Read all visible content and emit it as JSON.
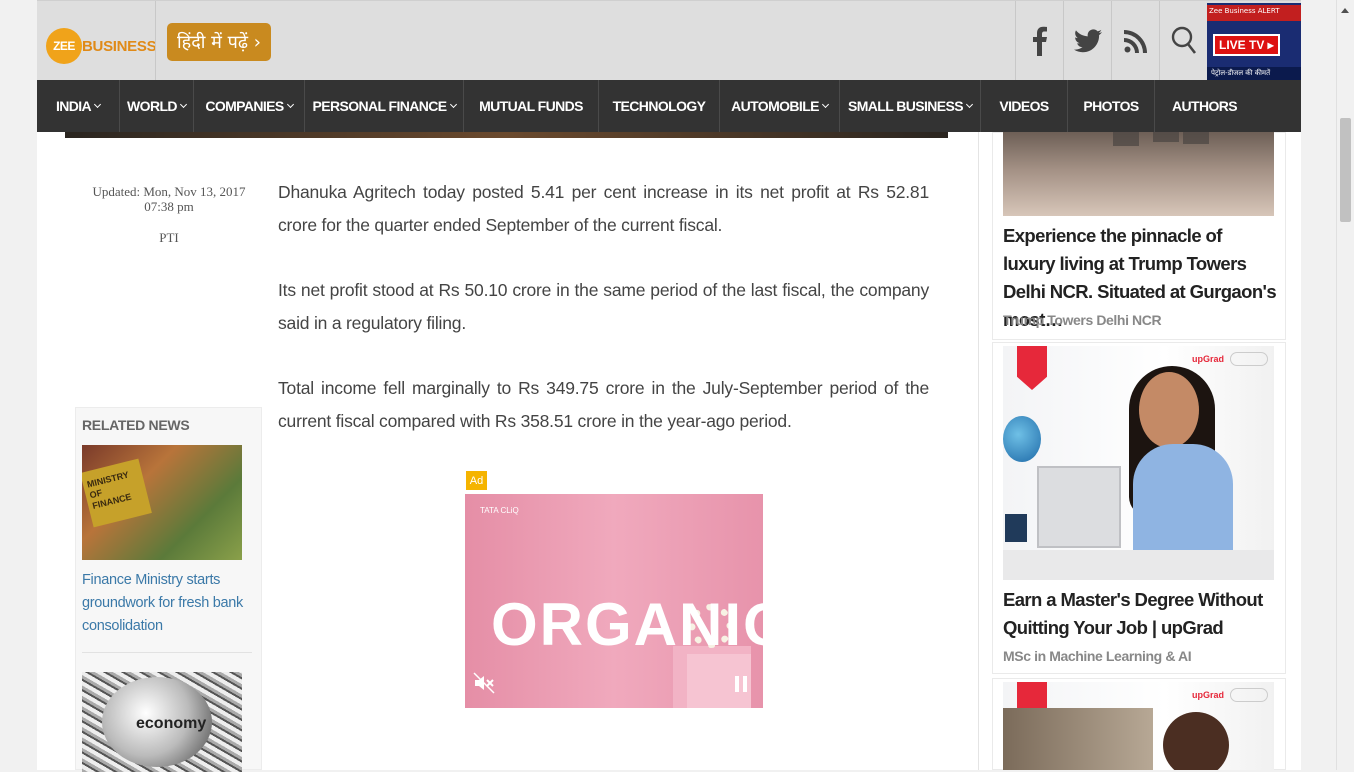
{
  "header": {
    "logo_badge": "ZEE",
    "logo_text": "BUSINESS",
    "hindi_button": "हिंदी में पढ़ें ›",
    "social_icons": [
      "facebook-icon",
      "twitter-icon",
      "rss-icon",
      "search-icon"
    ],
    "livetv": {
      "ticker": "Zee Business ALERT",
      "label": "LIVE TV ▸",
      "bottom_text": "पेट्रोल-डीजल की कीमतें"
    }
  },
  "nav": {
    "items": [
      {
        "label": "INDIA",
        "has_menu": true
      },
      {
        "label": "WORLD",
        "has_menu": true
      },
      {
        "label": "COMPANIES",
        "has_menu": true
      },
      {
        "label": "PERSONAL FINANCE",
        "has_menu": true
      },
      {
        "label": "MUTUAL FUNDS",
        "has_menu": false
      },
      {
        "label": "TECHNOLOGY",
        "has_menu": false
      },
      {
        "label": "AUTOMOBILE",
        "has_menu": true
      },
      {
        "label": "SMALL BUSINESS",
        "has_menu": true
      },
      {
        "label": "VIDEOS",
        "has_menu": false
      },
      {
        "label": "PHOTOS",
        "has_menu": false
      },
      {
        "label": "AUTHORS",
        "has_menu": false
      }
    ]
  },
  "article": {
    "updated": "Updated: Mon, Nov 13, 2017 07:38 pm",
    "author": "PTI",
    "paragraphs": [
      "Dhanuka Agritech today posted 5.41 per cent increase in its net profit at Rs 52.81 crore for the quarter ended September of the current fiscal.",
      "Its net profit stood at Rs 50.10 crore in the same period of the last fiscal, the company said in a regulatory filing.",
      "Total income fell marginally to Rs 349.75 crore in the July-September period of the current fiscal compared with Rs 358.51 crore in the year-ago period."
    ]
  },
  "related": {
    "heading": "RELATED NEWS",
    "items": [
      {
        "caption": "Finance Ministry starts groundwork for fresh bank consolidation",
        "image_text": "MINISTRY OF FINANCE"
      },
      {
        "caption": "",
        "image_text": "economy"
      }
    ]
  },
  "ad": {
    "badge": "Ad",
    "brand": "TATA CLiQ",
    "headline": "ORGANIQ",
    "mute_icon": "mute-icon",
    "pause_icon": "pause-icon"
  },
  "sidebar": {
    "cards": [
      {
        "title": "Experience the pinnacle of luxury living at Trump Towers Delhi NCR. Situated at Gurgaon's most…",
        "source": "Trump Towers Delhi NCR"
      },
      {
        "title": "Earn a Master's Degree Without Quitting Your Job | upGrad",
        "source": "MSc in Machine Learning & AI",
        "logo": "upGrad"
      },
      {
        "title": "",
        "source": "",
        "logo": "upGrad"
      }
    ]
  },
  "colors": {
    "nav_bg": "#333333",
    "header_bg": "#dedede",
    "brand_orange": "#e08a17",
    "link_blue": "#3b79a8",
    "ad_pink": "#f0a9bd",
    "upgrad_red": "#e6283a"
  }
}
